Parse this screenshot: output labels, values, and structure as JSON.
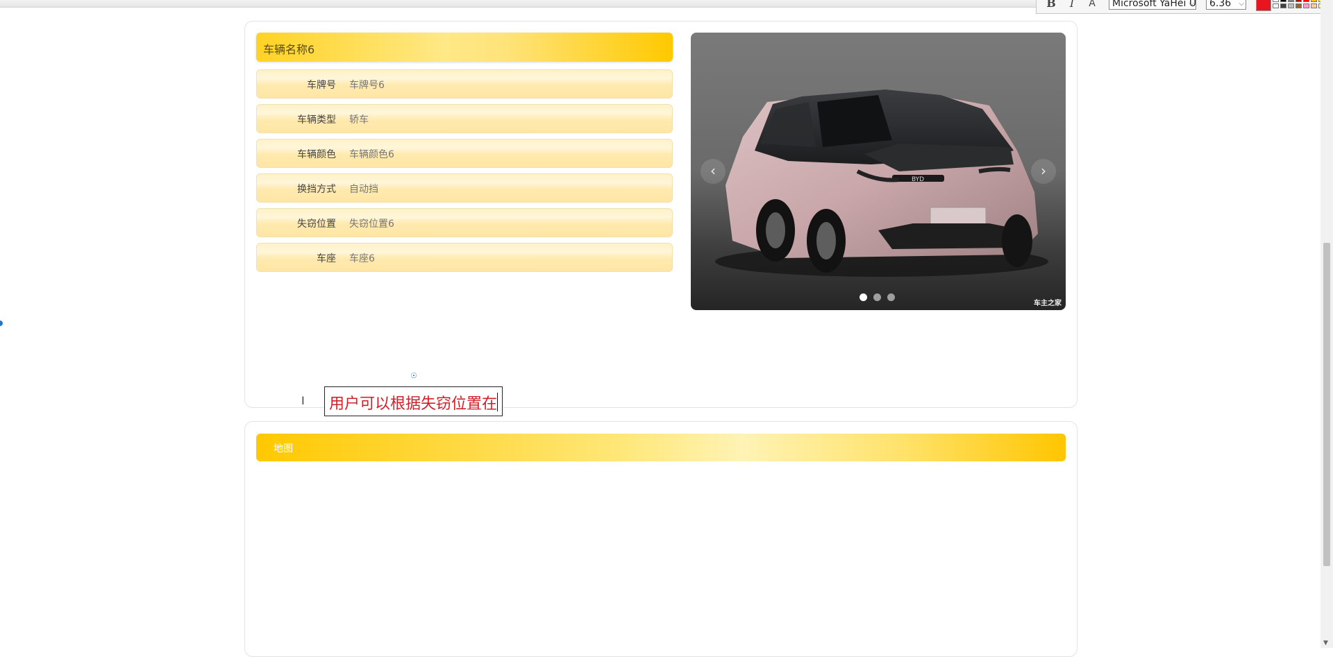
{
  "toolbar": {
    "bold_label": "B",
    "italic_label": "I",
    "outline_label": "A",
    "font_family": "Microsoft YaHei UI",
    "font_size": "6.36",
    "current_color": "#e8141e",
    "palette": [
      "#ffffff",
      "#000000",
      "#7f7f7f",
      "#c00000",
      "#ff0000",
      "#ffc000",
      "#ffff00",
      "#92d050",
      "#f2f2f2",
      "#404040",
      "#bfbfbf",
      "#996633",
      "#ff99cc",
      "#ffcc99",
      "#ffff99",
      "#ccffcc"
    ]
  },
  "vehicle": {
    "name": "车辆名称6",
    "rows": [
      {
        "label": "车牌号",
        "value": "车牌号6"
      },
      {
        "label": "车辆类型",
        "value": "轿车"
      },
      {
        "label": "车辆颜色",
        "value": "车辆颜色6"
      },
      {
        "label": "换挡方式",
        "value": "自动挡"
      },
      {
        "label": "失窃位置",
        "value": "失窃位置6"
      },
      {
        "label": "车座",
        "value": "车座6"
      }
    ]
  },
  "carousel": {
    "prev_label": "‹",
    "next_label": "›",
    "active_index": 0,
    "slide_count": 3,
    "watermark": "车主之家",
    "plate_text": "BYD"
  },
  "annotation": {
    "text": "用户可以根据失窃位置在"
  },
  "map": {
    "title": "地图"
  }
}
